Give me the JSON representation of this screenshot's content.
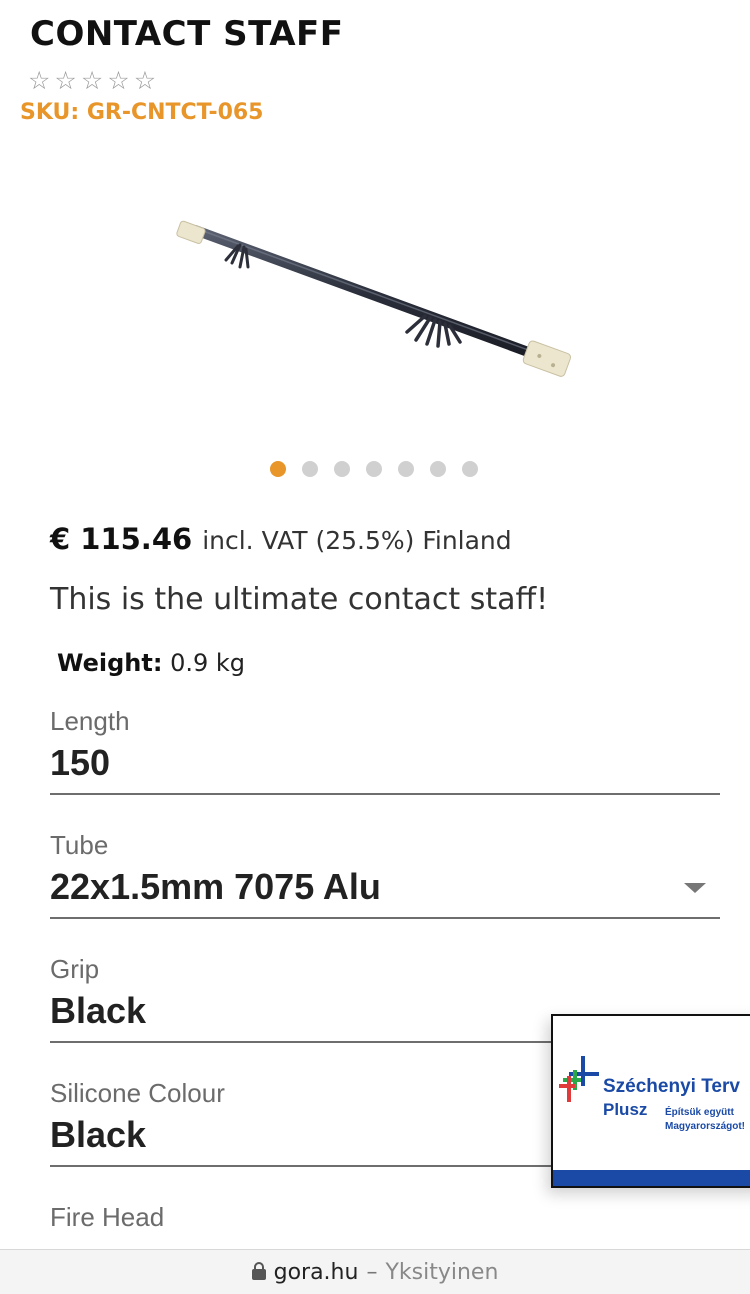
{
  "product": {
    "title": "CONTACT STAFF",
    "rating": {
      "value": 0,
      "max": 5
    },
    "sku": "SKU: GR-CNTCT-065",
    "image_icon": "contact-staff-photo",
    "gallery": {
      "count": 7,
      "active_index": 0
    },
    "price": "€ 115.46",
    "vat_text": "incl. VAT (25.5%) Finland",
    "description": "This is the ultimate contact staff!",
    "weight_label": "Weight:",
    "weight_value": "0.9 kg"
  },
  "options": [
    {
      "label": "Length",
      "value": "150",
      "dropdown": false
    },
    {
      "label": "Tube",
      "value": "22x1.5mm 7075 Alu",
      "dropdown": true
    },
    {
      "label": "Grip",
      "value": "Black",
      "dropdown": false
    },
    {
      "label": "Silicone Colour",
      "value": "Black",
      "dropdown": false
    },
    {
      "label": "Fire Head",
      "value": "",
      "dropdown": false
    }
  ],
  "badge": {
    "title": "Széchenyi Terv",
    "plus": "Plusz",
    "subtitle": "Építsük együtt Magyarországot!"
  },
  "browser": {
    "url": "gora.hu",
    "separator": "–",
    "privacy": "Yksityinen"
  },
  "colors": {
    "accent": "#e8952a",
    "badge_blue": "#1a4aa6"
  }
}
